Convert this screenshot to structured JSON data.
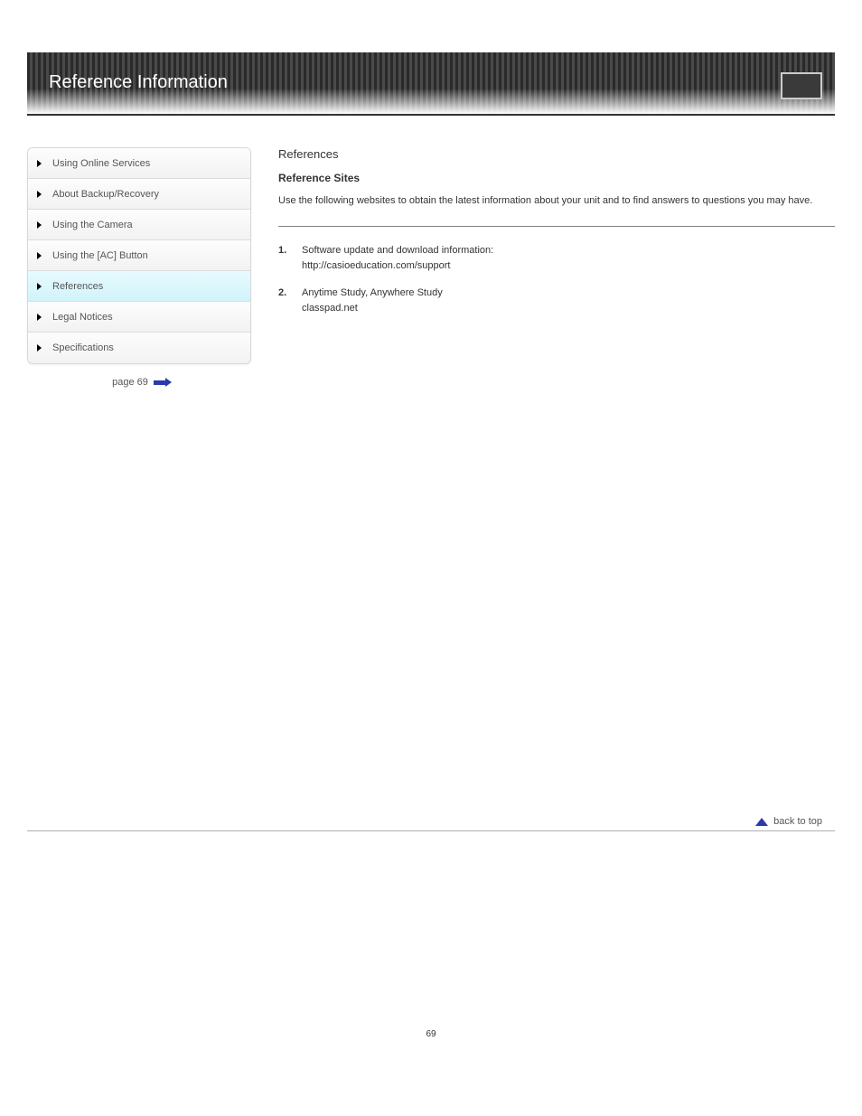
{
  "header": {
    "title": "Reference Information"
  },
  "sidebar": {
    "items": [
      {
        "label": "Using Online Services"
      },
      {
        "label": "About Backup/Recovery"
      },
      {
        "label": "Using the Camera"
      },
      {
        "label": "Using the [AC] Button"
      },
      {
        "label": "References"
      },
      {
        "label": "Legal Notices"
      },
      {
        "label": "Specifications"
      }
    ],
    "selected_index": 4,
    "page_label": "page 69"
  },
  "main": {
    "section_title": "References",
    "subsection_title": "Reference Sites",
    "intro": "Use the following websites to obtain the latest information about your unit and to find answers to questions you may have.",
    "refs": [
      {
        "bullet": "1.",
        "text": "Software update and download information:",
        "link": "http://casioeducation.com/support"
      },
      {
        "bullet": "2.",
        "text": "Anytime Study, Anywhere Study",
        "link": "classpad.net"
      }
    ]
  },
  "footer": {
    "back_to_top": "back to top",
    "page_number": "69"
  }
}
